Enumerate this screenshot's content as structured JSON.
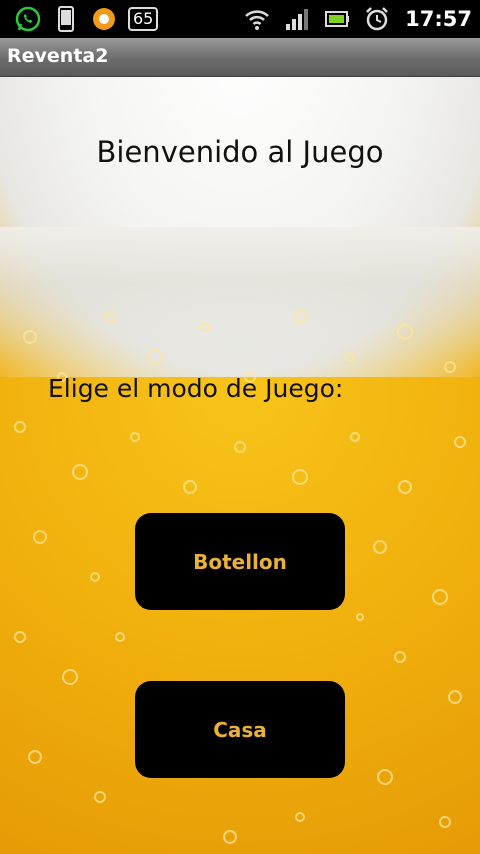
{
  "status_bar": {
    "icons": [
      "whatsapp-icon",
      "phone-icon",
      "orange-ring-icon"
    ],
    "badge_text": "65",
    "right_icons": [
      "wifi-icon",
      "signal-icon",
      "battery-icon",
      "alarm-icon"
    ],
    "time": "17:57"
  },
  "app": {
    "title": "Reventa2"
  },
  "main": {
    "welcome_text": "Bienvenido al Juego",
    "mode_prompt": "Elige el modo de Juego:",
    "buttons": [
      {
        "label": "Botellon"
      },
      {
        "label": "Casa"
      }
    ]
  },
  "colors": {
    "button_bg": "#000000",
    "button_text": "#e9b13a",
    "beer": "#f0ae0c",
    "foam": "#f4f4f2"
  }
}
